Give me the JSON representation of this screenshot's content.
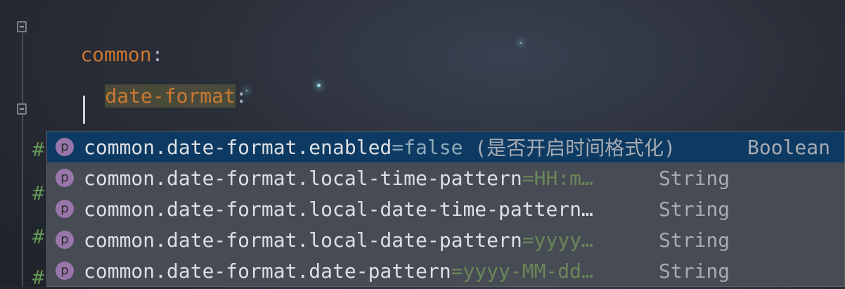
{
  "editor": {
    "line1_key": "common",
    "line1_colon": ":",
    "line2_key": "date-format",
    "line2_colon": ":",
    "comment_marker": "#"
  },
  "completion": {
    "icon_letter": "p",
    "items": [
      {
        "name": "common.date-format.enabled",
        "value": "=false",
        "hint": " (是否开启时间格式化) ",
        "type": "Boolean",
        "selected": true
      },
      {
        "name": "common.date-format.local-time-pattern",
        "value": "=HH:m…",
        "type": "String"
      },
      {
        "name": "common.date-format.local-date-time-pattern…",
        "value": "",
        "type": "String"
      },
      {
        "name": "common.date-format.local-date-pattern",
        "value": "=yyyy…",
        "type": "String"
      },
      {
        "name": "common.date-format.date-pattern",
        "value": "=yyyy-MM-dd…",
        "type": "String"
      }
    ]
  }
}
